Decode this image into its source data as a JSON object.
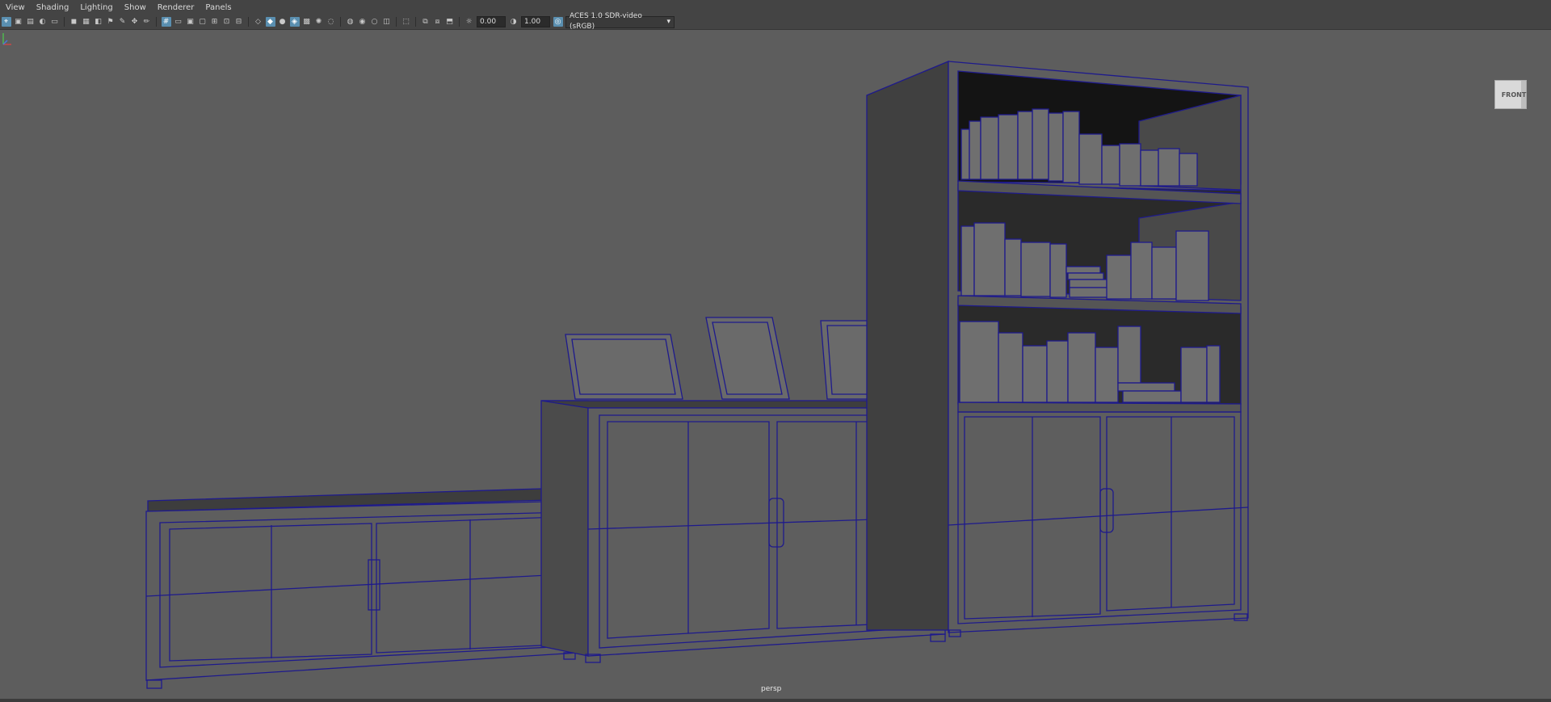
{
  "menu": [
    "View",
    "Shading",
    "Lighting",
    "Show",
    "Renderer",
    "Panels"
  ],
  "toolbar": {
    "exposure_value": "0.00",
    "gamma_value": "1.00",
    "color_space": "ACES 1.0 SDR-video (sRGB)"
  },
  "viewport": {
    "camera_label": "persp",
    "viewcube_label": "FRONT"
  },
  "colors": {
    "wireframe": "#1e1a8c",
    "viewport_bg": "#5d5d5d",
    "panel_bg": "#444444",
    "accent": "#5a8fb0"
  }
}
